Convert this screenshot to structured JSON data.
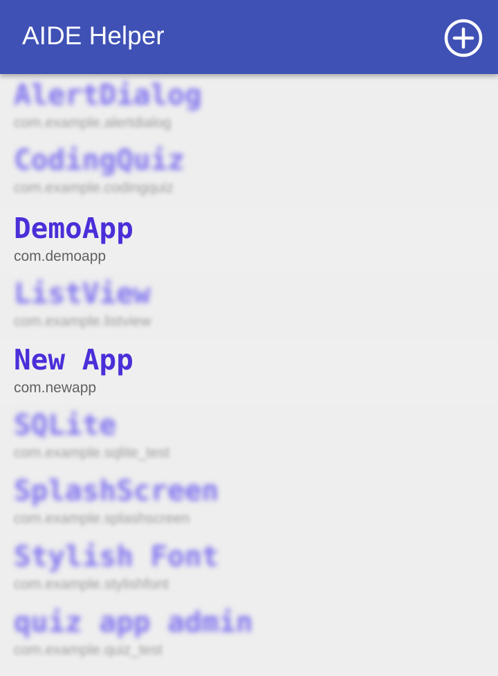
{
  "app_bar": {
    "title": "AIDE Helper",
    "add_icon": "plus-circle-icon",
    "color": "#3f51b5"
  },
  "projects": [
    {
      "name": "AlertDialog",
      "package": "com.example.alertdialog",
      "blurred": true
    },
    {
      "name": "CodingQuiz",
      "package": "com.example.codingquiz",
      "blurred": true
    },
    {
      "name": "DemoApp",
      "package": "com.demoapp",
      "blurred": false
    },
    {
      "name": "ListView",
      "package": "com.example.listview",
      "blurred": true
    },
    {
      "name": "New App",
      "package": "com.newapp",
      "blurred": false
    },
    {
      "name": "SQLite",
      "package": "com.example.sqlite_test",
      "blurred": true
    },
    {
      "name": "SplashScreen",
      "package": "com.example.splashscreen",
      "blurred": true
    },
    {
      "name": "Stylish Font",
      "package": "com.example.stylishfont",
      "blurred": true
    },
    {
      "name": "quiz app admin",
      "package": "com.example.quiz_test",
      "blurred": true
    }
  ],
  "colors": {
    "project_name": "#4a2fd9",
    "package": "#616161",
    "background": "#eeeeee"
  }
}
